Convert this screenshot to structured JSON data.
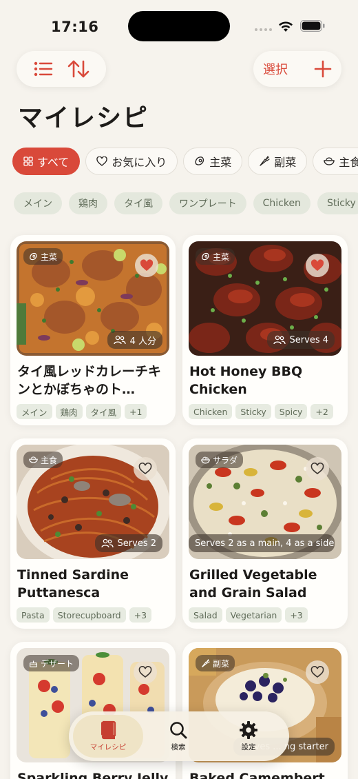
{
  "status_bar": {
    "time": "17:16"
  },
  "toolbar": {
    "select_label": "選択"
  },
  "page_title": "マイレシピ",
  "categories": [
    {
      "label": "すべて",
      "icon": "grid-icon",
      "active": true
    },
    {
      "label": "お気に入り",
      "icon": "heart-outline-icon",
      "active": false
    },
    {
      "label": "主菜",
      "icon": "meat-icon",
      "active": false
    },
    {
      "label": "副菜",
      "icon": "carrot-icon",
      "active": false
    },
    {
      "label": "主食",
      "icon": "bowl-icon",
      "active": false
    }
  ],
  "tags": [
    "メイン",
    "鶏肉",
    "タイ風",
    "ワンプレート",
    "Chicken",
    "Sticky"
  ],
  "recipes": [
    {
      "category": "主菜",
      "category_icon": "meat-icon",
      "favorite": true,
      "serves": "4 人分",
      "title": "タイ風レッドカレーチキンとかぼちゃのト…",
      "tags": [
        "メイン",
        "鶏肉",
        "タイ風",
        "+1"
      ]
    },
    {
      "category": "主菜",
      "category_icon": "meat-icon",
      "favorite": true,
      "serves": "Serves 4",
      "title": "Hot Honey BBQ Chicken",
      "tags": [
        "Chicken",
        "Sticky",
        "Spicy",
        "+2"
      ]
    },
    {
      "category": "主食",
      "category_icon": "bowl-icon",
      "favorite": false,
      "serves": "Serves 2",
      "title": "Tinned Sardine Puttanesca",
      "tags": [
        "Pasta",
        "Storecupboard",
        "+3"
      ]
    },
    {
      "category": "サラダ",
      "category_icon": "salad-icon",
      "favorite": false,
      "serves": "Serves 2 as a main, 4 as a side",
      "title": "Grilled Vegetable and Grain Salad",
      "tags": [
        "Salad",
        "Vegetarian",
        "+3"
      ]
    },
    {
      "category": "デザート",
      "category_icon": "cake-icon",
      "favorite": false,
      "title": "Sparkling Berry Jelly"
    },
    {
      "category": "副菜",
      "category_icon": "carrot-icon",
      "favorite": false,
      "serves": "Serves ... ng starter",
      "title": "Baked Camembert with"
    }
  ],
  "nav": [
    {
      "label": "マイレシピ",
      "icon": "book-icon",
      "active": true
    },
    {
      "label": "検索",
      "icon": "search-icon",
      "active": false
    },
    {
      "label": "設定",
      "icon": "gear-icon",
      "active": false
    }
  ],
  "colors": {
    "accent": "#d9493a",
    "background": "#f6f3ed",
    "tag_bg": "#e4e8dd",
    "tag_text": "#5f6b58"
  }
}
